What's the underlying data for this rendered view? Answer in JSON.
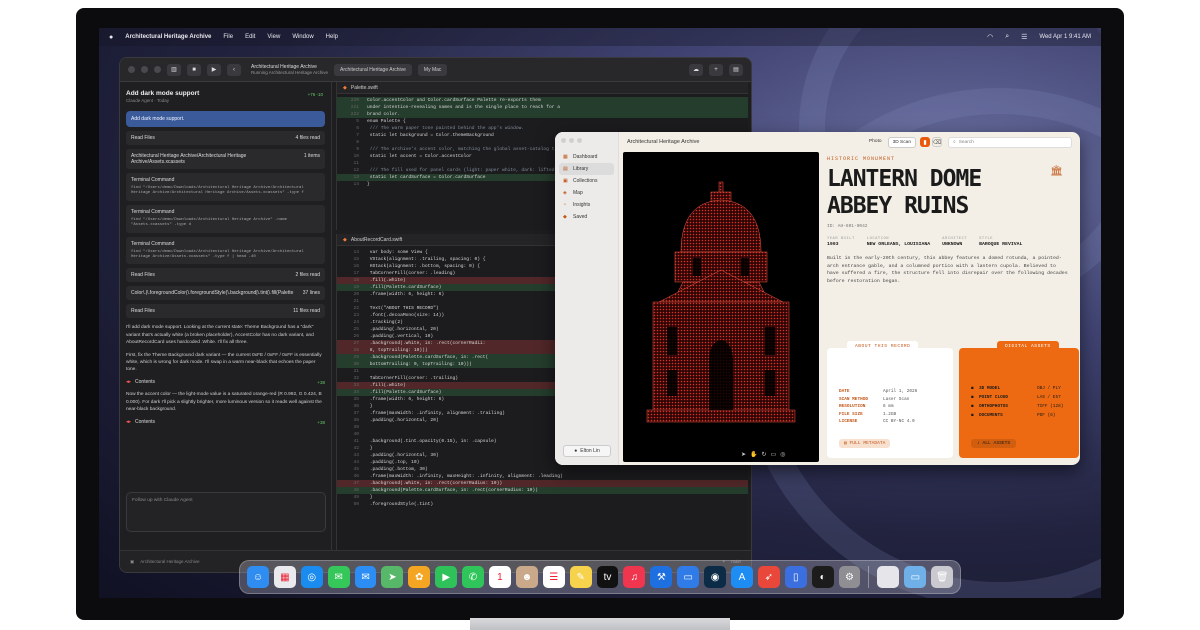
{
  "menubar": {
    "app_name": "Architectural Heritage Archive",
    "items": [
      "File",
      "Edit",
      "View",
      "Window",
      "Help"
    ],
    "clock": "Wed Apr 1 9:41 AM"
  },
  "xcode": {
    "scheme_title": "Architectural Heritage Archive",
    "scheme_sub": "Running Architectural Heritage Archive",
    "tab_project": "Architectural Heritage Archive",
    "tab_device": "My Mac",
    "panel_title": "Add dark mode support",
    "panel_sub": "Claude Agent · Today",
    "panel_meta": "+76 -10",
    "prompt": "Add dark mode support.",
    "read_files_1": {
      "label": "Read Files",
      "count": "4 files read"
    },
    "search_1": {
      "label": "Architectural Heritage Archive/Architectural Heritage Archive/Assets.xcassets",
      "count": "1 items"
    },
    "term_1": {
      "label": "Terminal Command",
      "body": "find \"/Users/demo/Downloads/Architectural Heritage Archive/Architectural Heritage Archive/Architectural Heritage Archive/Assets.xcassets\" -type f"
    },
    "term_2": {
      "label": "Terminal Command",
      "body": "find \"/Users/demo/Downloads/Architectural Heritage Archive\" -name \"Assets.xcassets\" -type d"
    },
    "term_3": {
      "label": "Terminal Command",
      "body": "find \"/Users/demo/Downloads/Architectural Heritage Archive/Architectural Heritage Archive/Assets.xcassets\" -type f | head -40"
    },
    "read_files_2": {
      "label": "Read Files",
      "count": "2 files read"
    },
    "search_2": {
      "label": "Color\\.|\\.foregroundColor(\\.foregroundStyle(\\.background|\\.tint(\\.fill(Palette",
      "count": "37 lines"
    },
    "read_files_3": {
      "label": "Read Files",
      "count": "11 files read"
    },
    "prose_1": "I'll add dark mode support. Looking at the current state: Theme Background has a \"dark\" variant that's actually white (a broken placeholder), AccentColor has no dark variant, and AboutRecordCard uses hardcoded .White. I'll fix all three.",
    "prose_2": "First, fix the Theme Background dark variant — the current 0xFE / 0xFF / 0xFF is essentially white, which is wrong for dark mode. I'll swap in a warm near-black that echoes the paper tone.",
    "contents_1": {
      "label": "Contents",
      "badge": "+38"
    },
    "prose_3": "Now the accent color — the light-mode value is a saturated orange-red (R 0.992, G 0.424, B 0.000). For dark I'll pick a slightly brighter, more luminous version so it reads well against the near-black background.",
    "contents_2": {
      "label": "Contents",
      "badge": "+38"
    },
    "chat_placeholder": "Follow up with Claude Agent",
    "status_project": "Architectural Heritage Archive",
    "status_branch": "main",
    "file_1": "Palette.swift",
    "file_2": "AboutRecordCard.swift"
  },
  "code_1": [
    {
      "n": "220",
      "t": "Color.accentColor and Color.cardSurface Palette re-exports them",
      "cls": "line-add"
    },
    {
      "n": "221",
      "t": "under intention-revealing names and is the single place to reach for a",
      "cls": "line-add"
    },
    {
      "n": "222",
      "t": "brand color.",
      "cls": "line-add"
    },
    {
      "n": "5",
      "t": "enum Palette {",
      "cls": ""
    },
    {
      "n": "6",
      "t": "    /// The warm paper tone painted behind the app's window.",
      "cls": ""
    },
    {
      "n": "7",
      "t": "    static let background = Color.themeBackground",
      "cls": ""
    },
    {
      "n": "8",
      "t": "",
      "cls": ""
    },
    {
      "n": "9",
      "t": "    /// The archive's accent color, matching the global asset-catalog tint.",
      "cls": ""
    },
    {
      "n": "10",
      "t": "    static let accent = Color.accentColor",
      "cls": ""
    },
    {
      "n": "11",
      "t": "",
      "cls": ""
    },
    {
      "n": "12",
      "t": "    /// The fill used for panel cards (light: paper white, dark: lifted neutral).",
      "cls": ""
    },
    {
      "n": "13",
      "t": "    static let cardSurface = Color.cardSurface",
      "cls": "line-add"
    },
    {
      "n": "14",
      "t": "}",
      "cls": ""
    }
  ],
  "code_2": [
    {
      "n": "14",
      "t": "    var body: some View {",
      "cls": ""
    },
    {
      "n": "15",
      "t": "        VStack(alignment: .trailing, spacing: 0) {",
      "cls": ""
    },
    {
      "n": "16",
      "t": "            HStack(alignment: .bottom, spacing: 0) {",
      "cls": ""
    },
    {
      "n": "17",
      "t": "                TabCornerFill(corner: .leading)",
      "cls": ""
    },
    {
      "n": "18",
      "t": "                    .fill(.white)",
      "cls": "line-del"
    },
    {
      "n": "19",
      "t": "                    .fill(Palette.cardSurface)",
      "cls": "line-add"
    },
    {
      "n": "20",
      "t": "                    .frame(width: 6, height: 6)",
      "cls": ""
    },
    {
      "n": "21",
      "t": "",
      "cls": ""
    },
    {
      "n": "22",
      "t": "                Text(\"ABOUT THIS RECORD\")",
      "cls": ""
    },
    {
      "n": "23",
      "t": "                    .font(.decoaMono(size: 14))",
      "cls": ""
    },
    {
      "n": "24",
      "t": "                    .tracking(2)",
      "cls": ""
    },
    {
      "n": "25",
      "t": "                    .padding(.horizontal, 20)",
      "cls": ""
    },
    {
      "n": "26",
      "t": "                    .padding(.vertical, 10)",
      "cls": ""
    },
    {
      "n": "27",
      "t": "                    .background(.white, in: .rect(cornerRadii:",
      "cls": "line-del"
    },
    {
      "n": "28",
      "t": "                        8, topTrailing: 10)))",
      "cls": "line-del"
    },
    {
      "n": "29",
      "t": "                    .background(Palette.cardSurface, in: .rect(",
      "cls": "line-add"
    },
    {
      "n": "30",
      "t": "                        bottomTrailing: 0, topTrailing: 10)))",
      "cls": "line-add"
    },
    {
      "n": "31",
      "t": "",
      "cls": ""
    },
    {
      "n": "32",
      "t": "                TabCornerFill(corner: .trailing)",
      "cls": ""
    },
    {
      "n": "33",
      "t": "                    .fill(.white)",
      "cls": "line-del"
    },
    {
      "n": "34",
      "t": "                    .fill(Palette.cardSurface)",
      "cls": "line-add"
    },
    {
      "n": "35",
      "t": "                    .frame(width: 6, height: 6)",
      "cls": ""
    },
    {
      "n": "36",
      "t": "            }",
      "cls": ""
    },
    {
      "n": "37",
      "t": "            .frame(maxWidth: .infinity, alignment: .trailing)",
      "cls": ""
    },
    {
      "n": "38",
      "t": "            .padding(.horizontal, 20)",
      "cls": ""
    },
    {
      "n": "39",
      "t": "",
      "cls": ""
    },
    {
      "n": "40",
      "t": "",
      "cls": ""
    },
    {
      "n": "41",
      "t": "            .background(.tint.opacity(0.15), in: .capsule)",
      "cls": ""
    },
    {
      "n": "42",
      "t": "        }",
      "cls": ""
    },
    {
      "n": "43",
      "t": "        .padding(.horizontal, 30)",
      "cls": ""
    },
    {
      "n": "44",
      "t": "        .padding(.top, 10)",
      "cls": ""
    },
    {
      "n": "45",
      "t": "        .padding(.bottom, 30)",
      "cls": ""
    },
    {
      "n": "46",
      "t": "        .frame(maxWidth: .infinity, maxHeight: .infinity, alignment: .leading)",
      "cls": ""
    },
    {
      "n": "47",
      "t": "        .background(.white, in: .rect(cornerRadius: 10))",
      "cls": "line-del"
    },
    {
      "n": "48",
      "t": "        .background(Palette.cardSurface, in: .rect(cornerRadius: 10))",
      "cls": "line-add"
    },
    {
      "n": "49",
      "t": "    }",
      "cls": ""
    },
    {
      "n": "50",
      "t": "    .foregroundStyle(.tint)",
      "cls": ""
    }
  ],
  "archive": {
    "window_title": "Architectural Heritage Archive",
    "nav": [
      {
        "label": "Dashboard",
        "icon": "dashboard-icon",
        "glyph": "▦"
      },
      {
        "label": "Library",
        "icon": "library-icon",
        "glyph": "▤"
      },
      {
        "label": "Collections",
        "icon": "collections-icon",
        "glyph": "▣"
      },
      {
        "label": "Map",
        "icon": "map-icon",
        "glyph": "◈"
      },
      {
        "label": "Insights",
        "icon": "insights-icon",
        "glyph": "◔"
      },
      {
        "label": "Saved",
        "icon": "saved-icon",
        "glyph": "◆"
      }
    ],
    "active_nav": 1,
    "user": "Elton Lin",
    "seg_photo": "Photo",
    "seg_scan": "3D Scan",
    "search_placeholder": "Search",
    "eyebrow": "HISTORIC MONUMENT",
    "title_line1": "LANTERN DOME",
    "title_line2": "ABBEY RUINS",
    "record_id": "ID: AH-601-0042",
    "facts": [
      {
        "k": "YEAR BUILT",
        "v": "1903"
      },
      {
        "k": "LOCATION",
        "v": "NEW ORLEANS, LOUISIANA"
      },
      {
        "k": "ARCHITECT",
        "v": "UNKNOWN"
      },
      {
        "k": "STYLE",
        "v": "BAROQUE REVIVAL"
      }
    ],
    "description": "Built in the early-20th century, this abbey features a domed rotunda, a pointed-arch entrance gable, and a columned portico with a lantern cupola. Believed to have suffered a fire, the structure fell into disrepair over the following decades before restoration began.",
    "about_tab": "ABOUT THIS RECORD",
    "record_rows": [
      {
        "k": "DATE",
        "v": "April 1, 2026"
      },
      {
        "k": "SCAN METHOD",
        "v": "Laser Scan"
      },
      {
        "k": "RESOLUTION",
        "v": "6 mm"
      },
      {
        "k": "FILE SIZE",
        "v": "1.2GB"
      },
      {
        "k": "LICENSE",
        "v": "CC BY-NC 4.0"
      }
    ],
    "full_metadata": "FULL METADATA",
    "assets_tab": "DIGITAL ASSETS",
    "asset_rows": [
      {
        "k": "3D MODEL",
        "v": "OBJ / PLY"
      },
      {
        "k": "POINT CLOUD",
        "v": "LAS / E57"
      },
      {
        "k": "ORTHOPHOTOS",
        "v": "TIFF (128)"
      },
      {
        "k": "DOCUMENTS",
        "v": "PDF (6)"
      }
    ],
    "all_assets": "ALL ASSETS",
    "colors": {
      "accent": "#ea5a0c",
      "paper": "#f3efe6",
      "scan_red": "#e0352a"
    }
  },
  "dock": [
    {
      "name": "finder-icon",
      "bg": "#2f8cf0",
      "glyph": "☺"
    },
    {
      "name": "launchpad-icon",
      "bg": "#e9e9ee",
      "glyph": "▦"
    },
    {
      "name": "safari-icon",
      "bg": "#1a8cf0",
      "glyph": "◎"
    },
    {
      "name": "messages-icon",
      "bg": "#36c75a",
      "glyph": "✉"
    },
    {
      "name": "mail-icon",
      "bg": "#2c8ef5",
      "glyph": "✉"
    },
    {
      "name": "maps-icon",
      "bg": "#58b86a",
      "glyph": "➤"
    },
    {
      "name": "photos-icon",
      "bg": "#f4a623",
      "glyph": "✿"
    },
    {
      "name": "facetime-icon",
      "bg": "#2fc25a",
      "glyph": "▶"
    },
    {
      "name": "phone-icon",
      "bg": "#30c55a",
      "glyph": "✆"
    },
    {
      "name": "calendar-icon",
      "bg": "#ffffff",
      "glyph": "1"
    },
    {
      "name": "contacts-icon",
      "bg": "#c9a98a",
      "glyph": "☻"
    },
    {
      "name": "reminders-icon",
      "bg": "#ffffff",
      "glyph": "☰"
    },
    {
      "name": "notes-icon",
      "bg": "#f7d24c",
      "glyph": "✎"
    },
    {
      "name": "tv-icon",
      "bg": "#111111",
      "glyph": "tv"
    },
    {
      "name": "music-icon",
      "bg": "#f0354f",
      "glyph": "♫"
    },
    {
      "name": "xcode-icon",
      "bg": "#1e6fe0",
      "glyph": "⚒"
    },
    {
      "name": "keynote-icon",
      "bg": "#2f7be8",
      "glyph": "▭"
    },
    {
      "name": "instruments-icon",
      "bg": "#0c2b46",
      "glyph": "◉"
    },
    {
      "name": "app-store-icon",
      "bg": "#1d8cf3",
      "glyph": "A"
    },
    {
      "name": "rocket-icon",
      "bg": "#e8473a",
      "glyph": "➶"
    },
    {
      "name": "archive-app-icon",
      "bg": "#3b6fe0",
      "glyph": "▯"
    },
    {
      "name": "preview-icon",
      "bg": "#1c1c1c",
      "glyph": "◐"
    },
    {
      "name": "settings-icon",
      "bg": "#8e8e93",
      "glyph": "⚙"
    },
    {
      "name": "sep",
      "bg": "",
      "glyph": ""
    },
    {
      "name": "blank-app-icon",
      "bg": "#e6e6ea",
      "glyph": ""
    },
    {
      "name": "downloads-folder-icon",
      "bg": "#6fb0e8",
      "glyph": "▭"
    },
    {
      "name": "trash-icon",
      "bg": "#c9c9cf",
      "glyph": "🗑"
    }
  ]
}
